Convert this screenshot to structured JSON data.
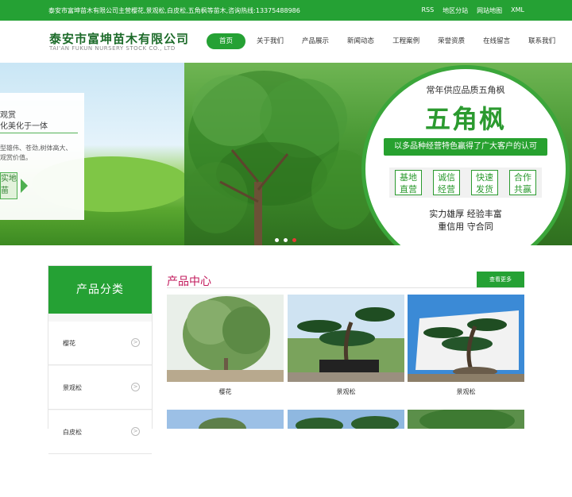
{
  "topbar": {
    "notice": "泰安市富坤苗木有限公司主营樱花,景观松,白皮松,五角枫等苗木,咨询热线:13375488986",
    "links": [
      "RSS",
      "地区分站",
      "网站地图",
      "XML"
    ]
  },
  "header": {
    "logo_cn": "泰安市富坤苗木有限公司",
    "logo_en": "TAI'AN FUKUN NURSERY STOCK CO., LTD"
  },
  "nav": {
    "items": [
      "首页",
      "关于我们",
      "产品展示",
      "新闻动态",
      "工程案例",
      "荣誉资质",
      "在线留言",
      "联系我们"
    ]
  },
  "banner": {
    "left_line1": "观赏",
    "left_line2": "化美化于一体",
    "left_line3": "型雄伟、苍劲,树体高大、",
    "left_line4": "观赏价值。",
    "left_badge": "实地苗",
    "circle_sub": "常年供应品质五角枫",
    "circle_title": "五角枫",
    "circle_bar": "以多品种经营特色赢得了广大客户的认可",
    "circle_boxes": [
      "基地直营",
      "诚信经营",
      "快速发货",
      "合作共赢"
    ],
    "slogan1": "实力雄厚 经验丰富",
    "slogan2": "重信用 守合同",
    "slides_total": 3,
    "slide_active": 3
  },
  "category": {
    "title": "产品分类",
    "items": [
      "樱花",
      "景观松",
      "白皮松"
    ]
  },
  "products": {
    "title": "产品中心",
    "more": "查看更多",
    "items": [
      {
        "name": "樱花"
      },
      {
        "name": "景观松"
      },
      {
        "name": "景观松"
      }
    ]
  },
  "colors": {
    "primary": "#25a134",
    "accent": "#c2185b"
  }
}
